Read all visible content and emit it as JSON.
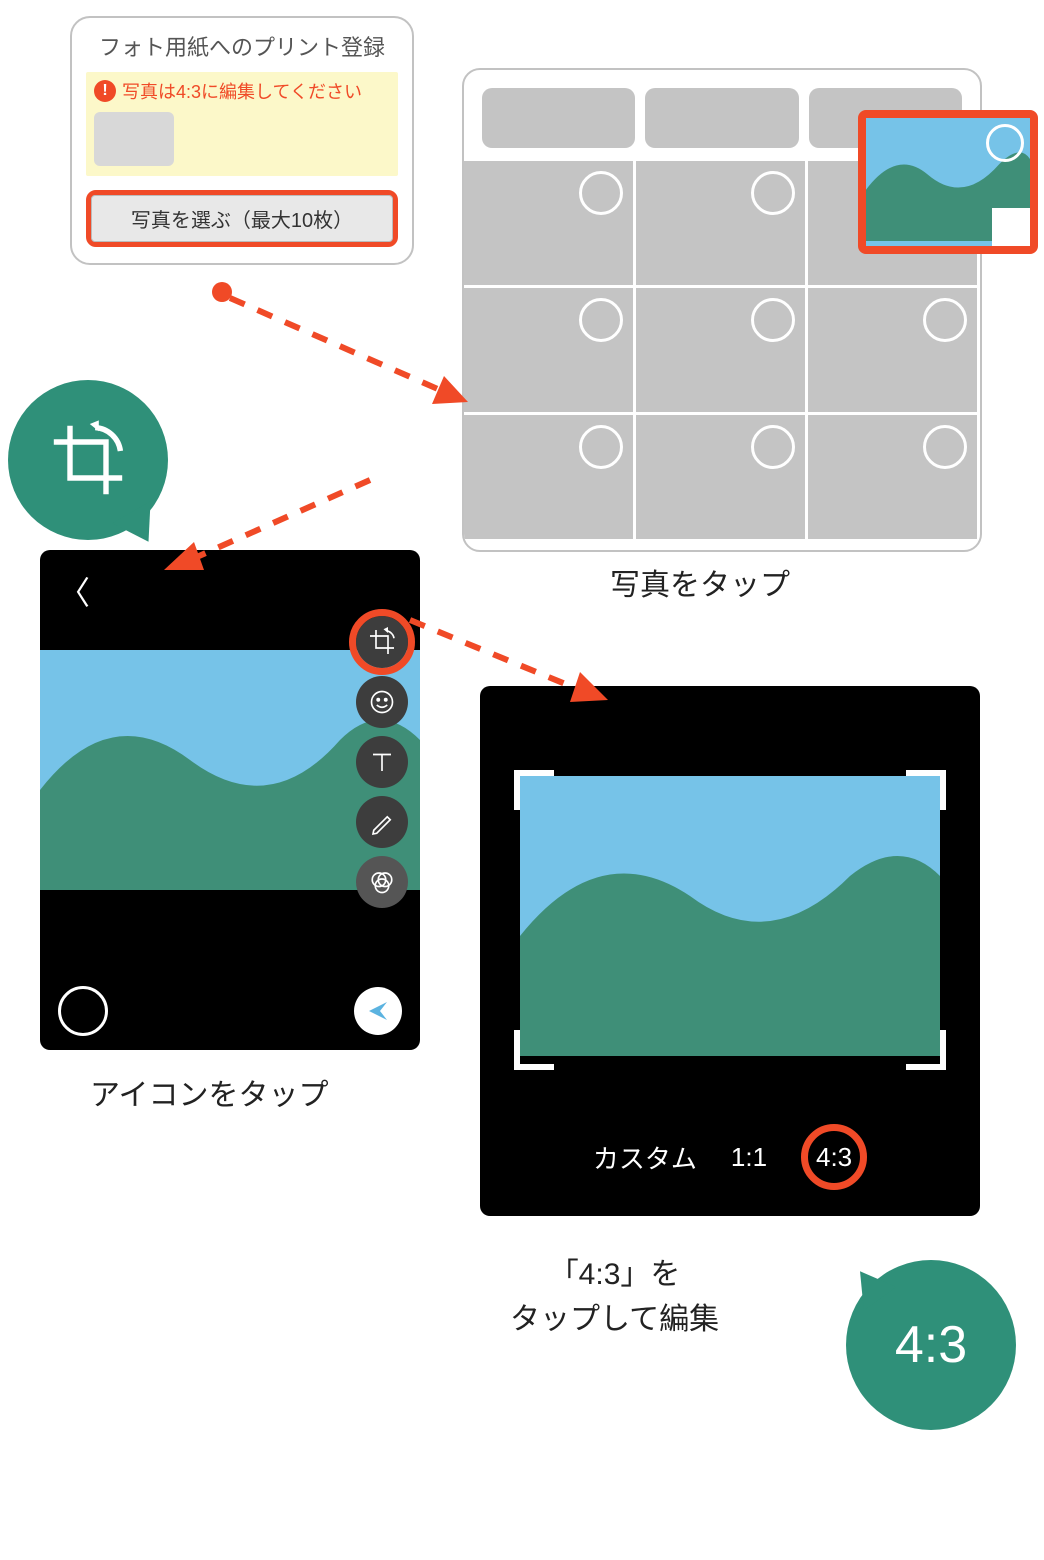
{
  "dialog": {
    "title": "フォト用紙へのプリント登録",
    "warning_icon": "!",
    "warning_text": "写真は4:3に編集してください",
    "select_button": "写真を選ぶ（最大10枚）"
  },
  "picker": {
    "caption": "写真をタップ"
  },
  "editor": {
    "caption": "アイコンをタップ",
    "tools": {
      "crop": "crop-icon",
      "smile": "smile-icon",
      "text": "text-icon",
      "pencil": "pencil-icon",
      "filter": "filter-icon"
    }
  },
  "crop": {
    "options": {
      "custom": "カスタム",
      "one_one": "1:1",
      "four_three": "4:3"
    },
    "caption_line1": "「4:3」を",
    "caption_line2": "タップして編集"
  },
  "ratio_bubble": "4:3"
}
